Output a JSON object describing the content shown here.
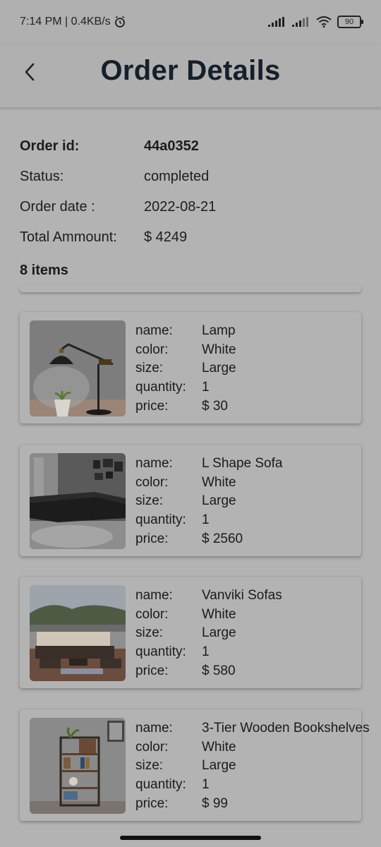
{
  "status_bar": {
    "time_speed": "7:14 PM | 0.4KB/s",
    "battery": "90"
  },
  "header": {
    "title": "Order Details"
  },
  "order": {
    "id_label": "Order id:",
    "id_value": "44a0352",
    "status_label": "Status:",
    "status_value": "completed",
    "date_label": "Order date :",
    "date_value": "2022-08-21",
    "total_label": "Total Ammount:",
    "total_value": "$ 4249",
    "items_count": "8 items"
  },
  "field_labels": {
    "name": "name:",
    "color": "color:",
    "size": "size:",
    "quantity": "quantity:",
    "price": "price:"
  },
  "items": [
    {
      "name": "Lamp",
      "color": "White",
      "size": "Large",
      "quantity": "1",
      "price": "$ 30"
    },
    {
      "name": "L Shape Sofa",
      "color": "White",
      "size": "Large",
      "quantity": "1",
      "price": "$ 2560"
    },
    {
      "name": "Vanviki Sofas",
      "color": "White",
      "size": "Large",
      "quantity": "1",
      "price": "$ 580"
    },
    {
      "name": "3-Tier Wooden Bookshelves",
      "color": "White",
      "size": "Large",
      "quantity": "1",
      "price": "$ 99"
    }
  ]
}
